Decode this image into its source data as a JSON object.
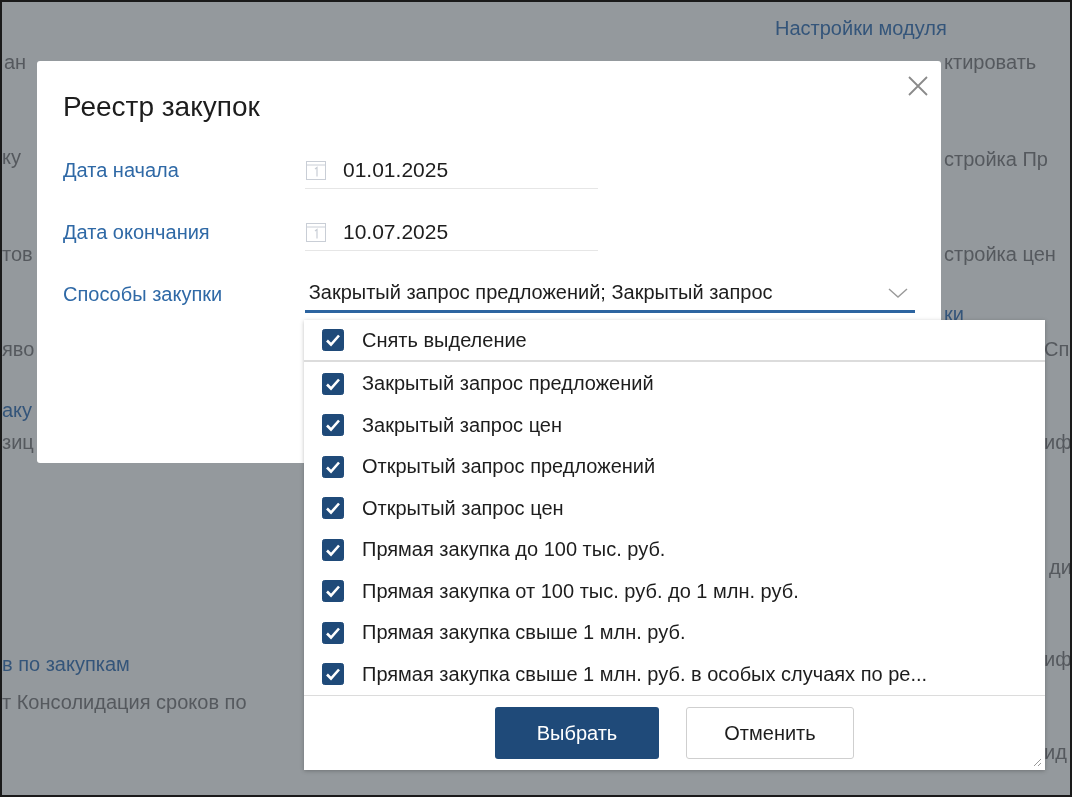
{
  "background": {
    "texts": [
      {
        "text": "Настройки модуля",
        "kind": "link"
      },
      {
        "text": "ктировать",
        "kind": "text"
      },
      {
        "text": "ан",
        "kind": "text"
      },
      {
        "text": "ку",
        "kind": "text"
      },
      {
        "text": "стройка Пр",
        "kind": "text"
      },
      {
        "text": "тов",
        "kind": "text"
      },
      {
        "text": "стройка цен",
        "kind": "text"
      },
      {
        "text": "ки",
        "kind": "link"
      },
      {
        "text": "яво",
        "kind": "text"
      },
      {
        "text": "Сп",
        "kind": "text"
      },
      {
        "text": "аку",
        "kind": "link"
      },
      {
        "text": "зиц",
        "kind": "text"
      },
      {
        "text": "иф",
        "kind": "text"
      },
      {
        "text": "ди",
        "kind": "text"
      },
      {
        "text": "в по закупкам",
        "kind": "link"
      },
      {
        "text": "иф",
        "kind": "text"
      },
      {
        "text": "т Консолидация сроков по",
        "kind": "text"
      },
      {
        "text": "ид",
        "kind": "text"
      }
    ]
  },
  "dialog": {
    "title": "Реестр закупок",
    "fields": [
      {
        "kind": "date",
        "label": "Дата начала",
        "value": "01.01.2025"
      },
      {
        "kind": "date",
        "label": "Дата окончания",
        "value": "10.07.2025"
      },
      {
        "kind": "multiselect",
        "label": "Способы закупки",
        "value": "Закрытый запрос предложений; Закрытый запрос",
        "expanded": true
      }
    ]
  },
  "dropdown": {
    "select_all": {
      "label": "Снять выделение",
      "checked": true
    },
    "options": [
      {
        "label": "Закрытый запрос предложений",
        "checked": true
      },
      {
        "label": "Закрытый запрос цен",
        "checked": true
      },
      {
        "label": "Открытый запрос предложений",
        "checked": true
      },
      {
        "label": "Открытый запрос цен",
        "checked": true
      },
      {
        "label": "Прямая закупка до 100 тыс. руб.",
        "checked": true
      },
      {
        "label": "Прямая закупка от 100 тыс. руб. до 1 млн. руб.",
        "checked": true
      },
      {
        "label": "Прямая закупка свыше 1 млн. руб.",
        "checked": true
      },
      {
        "label": "Прямая закупка свыше 1 млн. руб. в особых случаях по ре...",
        "checked": true
      }
    ],
    "buttons": [
      {
        "label": "Выбрать",
        "kind": "primary"
      },
      {
        "label": "Отменить",
        "kind": "secondary"
      }
    ]
  }
}
